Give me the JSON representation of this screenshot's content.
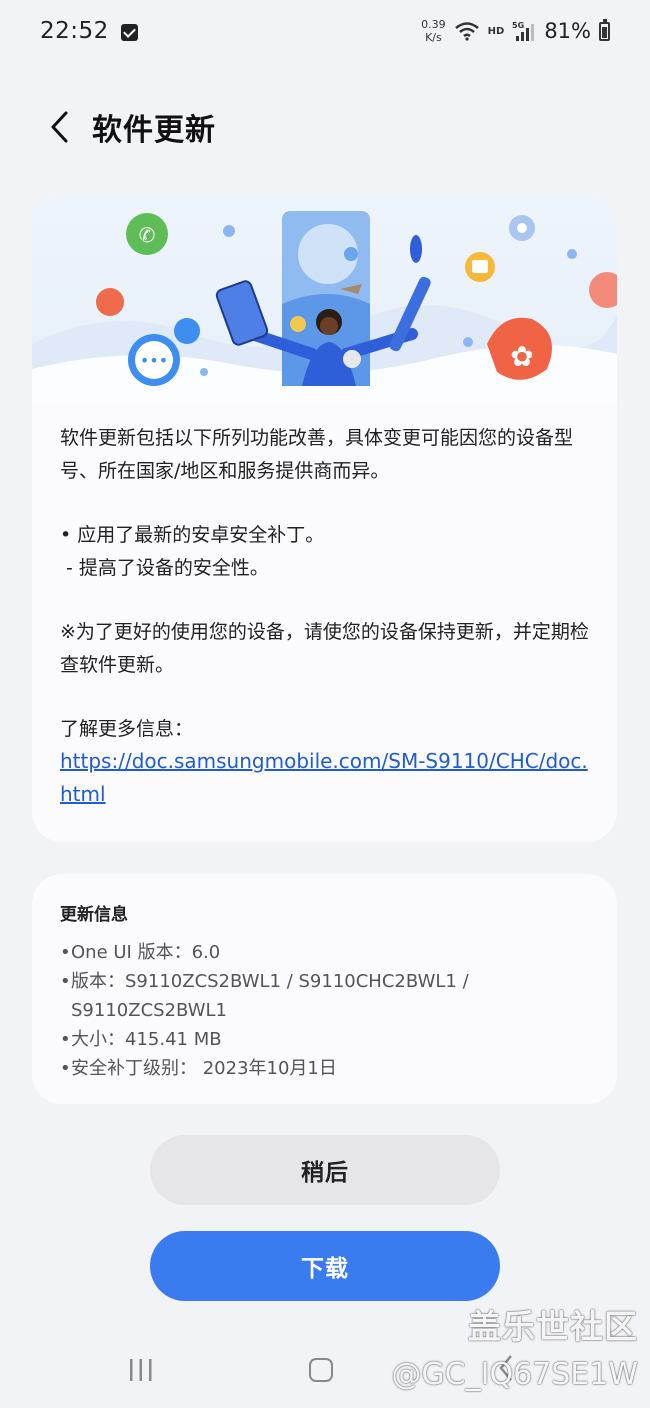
{
  "status_bar": {
    "time": "22:52",
    "net_speed_value": "0.39",
    "net_speed_unit": "K/s",
    "hd_label": "HD",
    "network_label": "5G",
    "battery": "81%"
  },
  "header": {
    "title": "软件更新"
  },
  "release_notes": {
    "intro": "软件更新包括以下所列功能改善，具体变更可能因您的设备型号、所在国家/地区和服务提供商而异。",
    "item_main": "• 应用了最新的安卓安全补丁。",
    "item_sub": " - 提高了设备的安全性。",
    "note": "※为了更好的使用您的设备，请使您的设备保持更新，并定期检查软件更新。",
    "more_info_label": "了解更多信息：",
    "more_info_link": "https://doc.samsungmobile.com/SM-S9110/CHC/doc.html"
  },
  "update_info": {
    "title": "更新信息",
    "items": [
      "One UI 版本：6.0",
      "版本：S9110ZCS2BWL1 / S9110CHC2BWL1 / S9110ZCS2BWL1",
      "大小：415.41 MB",
      "安全补丁级别： 2023年10月1日"
    ]
  },
  "actions": {
    "later_label": "稍后",
    "download_label": "下载"
  },
  "watermark": {
    "site": "盖乐世社区",
    "user": "@GC_IQ67SE1W"
  },
  "colors": {
    "accent": "#3a7cf0",
    "link": "#1f5bd6",
    "background": "#f2f3f7",
    "card": "#fbfbfd"
  }
}
